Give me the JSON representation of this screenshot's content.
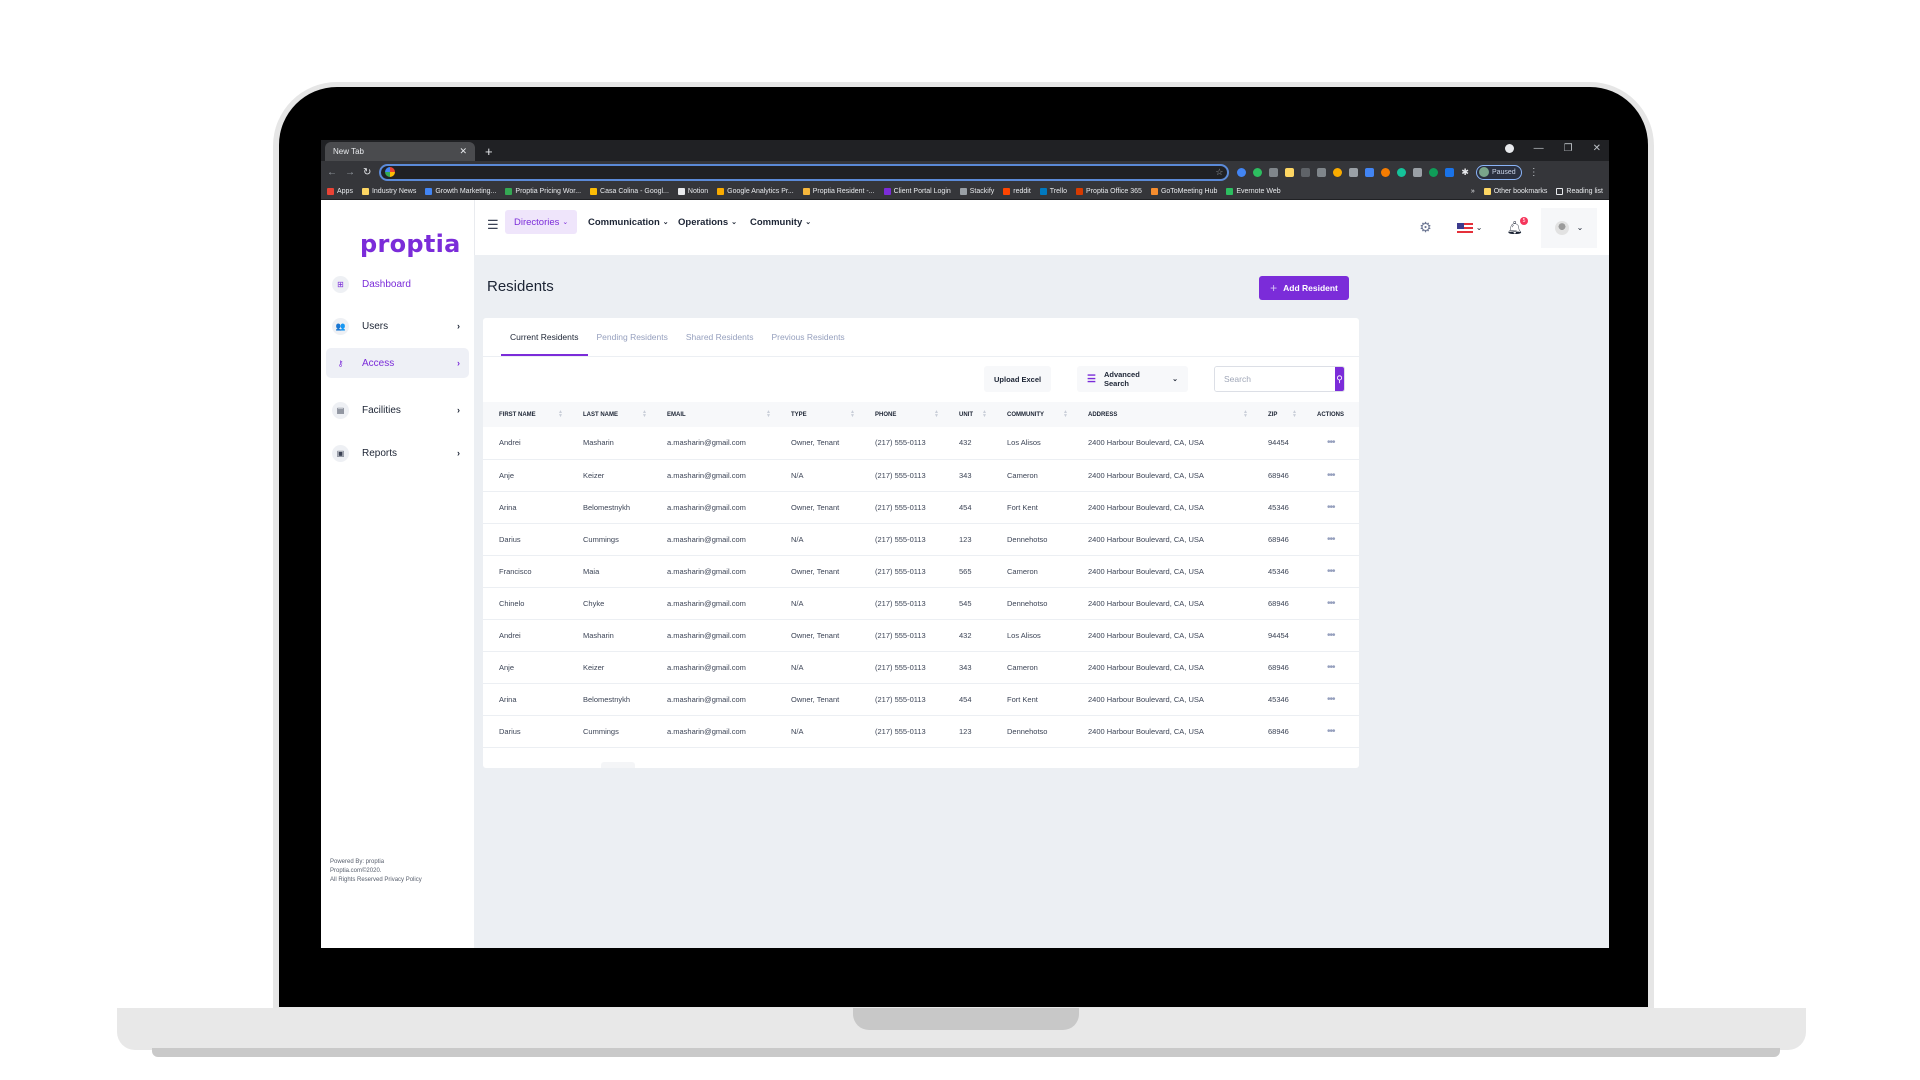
{
  "browser": {
    "tab_title": "New Tab",
    "new_tab_symbol": "+",
    "profile_status": "Paused",
    "bookmarks": [
      {
        "label": "Apps",
        "color": "#ea4335"
      },
      {
        "label": "Industry News",
        "color": "#fdd663"
      },
      {
        "label": "Growth Marketing...",
        "color": "#4285f4"
      },
      {
        "label": "Proptia Pricing Wor...",
        "color": "#34a853"
      },
      {
        "label": "Casa Colina - Googl...",
        "color": "#fbbc05"
      },
      {
        "label": "Notion",
        "color": "#e8eaed"
      },
      {
        "label": "Google Analytics Pr...",
        "color": "#f9ab00"
      },
      {
        "label": "Proptia Resident -...",
        "color": "#f6b73c"
      },
      {
        "label": "Client Portal Login",
        "color": "#7b2cd9"
      },
      {
        "label": "Stackify",
        "color": "#9aa0a6"
      },
      {
        "label": "reddit",
        "color": "#ff4500"
      },
      {
        "label": "Trello",
        "color": "#0079bf"
      },
      {
        "label": "Proptia Office 365",
        "color": "#d83b01"
      },
      {
        "label": "GoToMeeting Hub",
        "color": "#f68d2e"
      },
      {
        "label": "Evernote Web",
        "color": "#2dbe60"
      }
    ],
    "bookmarks_overflow": "»",
    "other_bookmarks": "Other bookmarks",
    "reading_list": "Reading list"
  },
  "sidebar": {
    "logo": "proptia",
    "items": [
      {
        "label": "Dashboard",
        "icon": "grid-icon",
        "glyph": "⊞",
        "has_chevron": false
      },
      {
        "label": "Users",
        "icon": "users-icon",
        "glyph": "👥",
        "has_chevron": true
      },
      {
        "label": "Access",
        "icon": "key-icon",
        "glyph": "⚷",
        "has_chevron": true
      },
      {
        "label": "Facilities",
        "icon": "building-icon",
        "glyph": "▤",
        "has_chevron": true
      },
      {
        "label": "Reports",
        "icon": "clipboard-icon",
        "glyph": "▣",
        "has_chevron": true
      }
    ],
    "chevron": "›",
    "footer": {
      "line1": "Powered By: proptia",
      "line2": "Proptia.com©2020.",
      "line3": "All Rights Reserved Privacy Policy"
    }
  },
  "topbar": {
    "menus": [
      {
        "label": "Directories",
        "selected": true
      },
      {
        "label": "Communication",
        "selected": false
      },
      {
        "label": "Operations",
        "selected": false
      },
      {
        "label": "Community",
        "selected": false
      }
    ],
    "notification_count": "5"
  },
  "page": {
    "title": "Residents",
    "add_button": "Add Resident",
    "tabs": [
      {
        "label": "Current Residents",
        "active": true
      },
      {
        "label": "Pending Residents",
        "active": false
      },
      {
        "label": "Shared Residents",
        "active": false
      },
      {
        "label": "Previous Residents",
        "active": false
      }
    ],
    "upload_button": "Upload Excel",
    "advanced_search": "Advanced Search",
    "search_placeholder": "Search",
    "search_value": ""
  },
  "table": {
    "columns": [
      "FIRST NAME",
      "LAST NAME",
      "EMAIL",
      "TYPE",
      "PHONE",
      "UNIT",
      "COMMUNITY",
      "ADDRESS",
      "ZIP",
      "ACTIONS"
    ],
    "rows": [
      [
        "Andrei",
        "Masharin",
        "a.masharin@gmail.com",
        "Owner, Tenant",
        "(217) 555-0113",
        "432",
        "Los Alisos",
        "2400 Harbour Boulevard, CA, USA",
        "94454"
      ],
      [
        "Anje",
        "Keizer",
        "a.masharin@gmail.com",
        "N/A",
        "(217) 555-0113",
        "343",
        "Cameron",
        "2400 Harbour Boulevard, CA, USA",
        "68946"
      ],
      [
        "Arina",
        "Belomestnykh",
        "a.masharin@gmail.com",
        "Owner, Tenant",
        "(217) 555-0113",
        "454",
        "Fort Kent",
        "2400 Harbour Boulevard, CA, USA",
        "45346"
      ],
      [
        "Darius",
        "Cummings",
        "a.masharin@gmail.com",
        "N/A",
        "(217) 555-0113",
        "123",
        "Dennehotso",
        "2400 Harbour Boulevard, CA, USA",
        "68946"
      ],
      [
        "Francisco",
        "Maia",
        "a.masharin@gmail.com",
        "Owner, Tenant",
        "(217) 555-0113",
        "565",
        "Cameron",
        "2400 Harbour Boulevard, CA, USA",
        "45346"
      ],
      [
        "Chinelo",
        "Chyke",
        "a.masharin@gmail.com",
        "N/A",
        "(217) 555-0113",
        "545",
        "Dennehotso",
        "2400 Harbour Boulevard, CA, USA",
        "68946"
      ],
      [
        "Andrei",
        "Masharin",
        "a.masharin@gmail.com",
        "Owner, Tenant",
        "(217) 555-0113",
        "432",
        "Los Alisos",
        "2400 Harbour Boulevard, CA, USA",
        "94454"
      ],
      [
        "Anje",
        "Keizer",
        "a.masharin@gmail.com",
        "N/A",
        "(217) 555-0113",
        "343",
        "Cameron",
        "2400 Harbour Boulevard, CA, USA",
        "68946"
      ],
      [
        "Arina",
        "Belomestnykh",
        "a.masharin@gmail.com",
        "Owner, Tenant",
        "(217) 555-0113",
        "454",
        "Fort Kent",
        "2400 Harbour Boulevard, CA, USA",
        "45346"
      ],
      [
        "Darius",
        "Cummings",
        "a.masharin@gmail.com",
        "N/A",
        "(217) 555-0113",
        "123",
        "Dennehotso",
        "2400 Harbour Boulevard, CA, USA",
        "68946"
      ]
    ],
    "action_glyph": "•••"
  },
  "colors": {
    "brand": "#7b2cd9",
    "notification": "#f5365c"
  }
}
